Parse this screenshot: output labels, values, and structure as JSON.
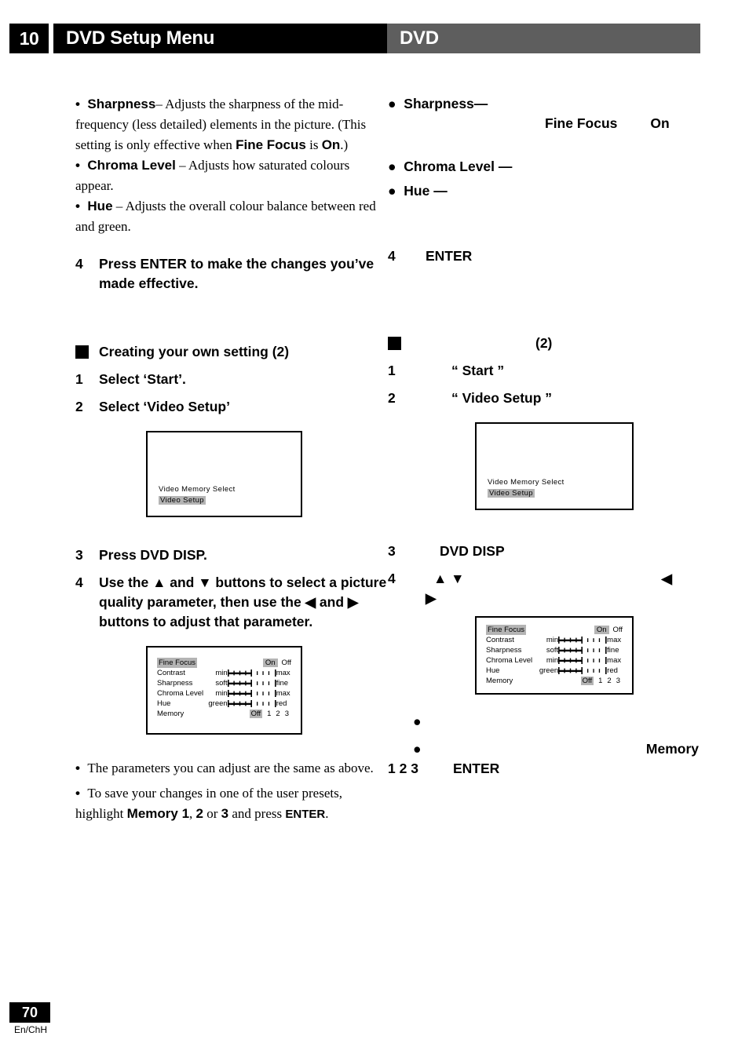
{
  "header": {
    "chapter_number": "10",
    "title": "DVD Setup Menu",
    "right_label": "DVD",
    "black": "#000000",
    "gray": "#5e5e5e"
  },
  "left_column": {
    "bullets_intro": [
      {
        "term": "Sharpness",
        "dash": "–",
        "text_1": " Adjusts the sharpness of the mid-frequency (less detailed) elements in the picture. (This setting is only effective when ",
        "bold_1": "Fine Focus",
        "text_2": " is ",
        "bold_2": "On",
        "text_3": ".)"
      },
      {
        "term": "Chroma Level",
        "dash": "–",
        "text_1": " Adjusts how saturated colours appear."
      },
      {
        "term": "Hue",
        "dash": "–",
        "text_1": " Adjusts the overall colour balance between red and green."
      }
    ],
    "step_4_top": {
      "num": "4",
      "text": "Press ENTER to make the changes you’ve made effective."
    },
    "section_heading": "Creating your own setting (2)",
    "steps": [
      {
        "num": "1",
        "text": "Select ‘Start’."
      },
      {
        "num": "2",
        "text": "Select ‘Video Setup’"
      },
      {
        "num": "3",
        "text": "Press DVD DISP."
      },
      {
        "num": "4",
        "text": "Use the ▲ and ▼ buttons to select a picture quality parameter, then use the ◀ and ▶ buttons to adjust that parameter."
      }
    ],
    "notes": [
      {
        "text_1": "The parameters you can adjust are the same as above."
      },
      {
        "text_1": "To save your changes in one of the user presets, highlight ",
        "bold_1": "Memory 1",
        "text_2": ", ",
        "bold_2": "2",
        "text_3": " or ",
        "bold_3": "3",
        "text_4": " and press ",
        "bold_4": "ENTER",
        "text_5": "."
      }
    ]
  },
  "right_column": {
    "bullets_intro": [
      {
        "term": "Sharpness",
        "dash": "—"
      },
      {
        "term": "Chroma Level",
        "dash": "—"
      },
      {
        "term": "Hue",
        "dash": "—"
      }
    ],
    "inline_note": {
      "bold_1": "Fine Focus",
      "bold_2": "On"
    },
    "step_4_top": {
      "num": "4",
      "text": "ENTER"
    },
    "section_heading": "(2)",
    "steps": [
      {
        "num": "1",
        "text": "“ Start ”"
      },
      {
        "num": "2",
        "text": "“ Video Setup ”"
      },
      {
        "num": "3",
        "text": "DVD DISP"
      },
      {
        "num": "4",
        "text": "▲   ▼",
        "text_right": "◀",
        "text_cont": "▶"
      }
    ],
    "notes": [
      {
        "bullet": "●",
        "text": ""
      },
      {
        "bullet": "●",
        "text": "",
        "right_bold": "Memory"
      }
    ],
    "note_line": {
      "digits": "1   2   3",
      "enter": "ENTER"
    }
  },
  "osd_menu_screen": {
    "line_1": "Video Memory Select",
    "line_2_highlighted": "Video Setup"
  },
  "osd_param_screen": {
    "rows": [
      {
        "label": "Fine Focus",
        "label_highlighted": true,
        "type": "onoff",
        "on": "On",
        "off": "Off",
        "selected": "On"
      },
      {
        "label": "Contrast",
        "label_highlighted": false,
        "type": "slider",
        "min_label": "min",
        "max_label": "max",
        "value": 4,
        "steps": 8
      },
      {
        "label": "Sharpness",
        "label_highlighted": false,
        "type": "slider",
        "min_label": "soft",
        "max_label": "fine",
        "value": 4,
        "steps": 8
      },
      {
        "label": "Chroma Level",
        "label_highlighted": false,
        "type": "slider",
        "min_label": "min",
        "max_label": "max",
        "value": 4,
        "steps": 8
      },
      {
        "label": "Hue",
        "label_highlighted": false,
        "type": "slider",
        "min_label": "green",
        "max_label": "red",
        "value": 4,
        "steps": 8
      },
      {
        "label": "Memory",
        "label_highlighted": false,
        "type": "memory",
        "off": "Off",
        "presets": [
          "1",
          "2",
          "3"
        ],
        "selected": "Off"
      }
    ]
  },
  "footer": {
    "page_number": "70",
    "language_code": "En/ChH"
  }
}
